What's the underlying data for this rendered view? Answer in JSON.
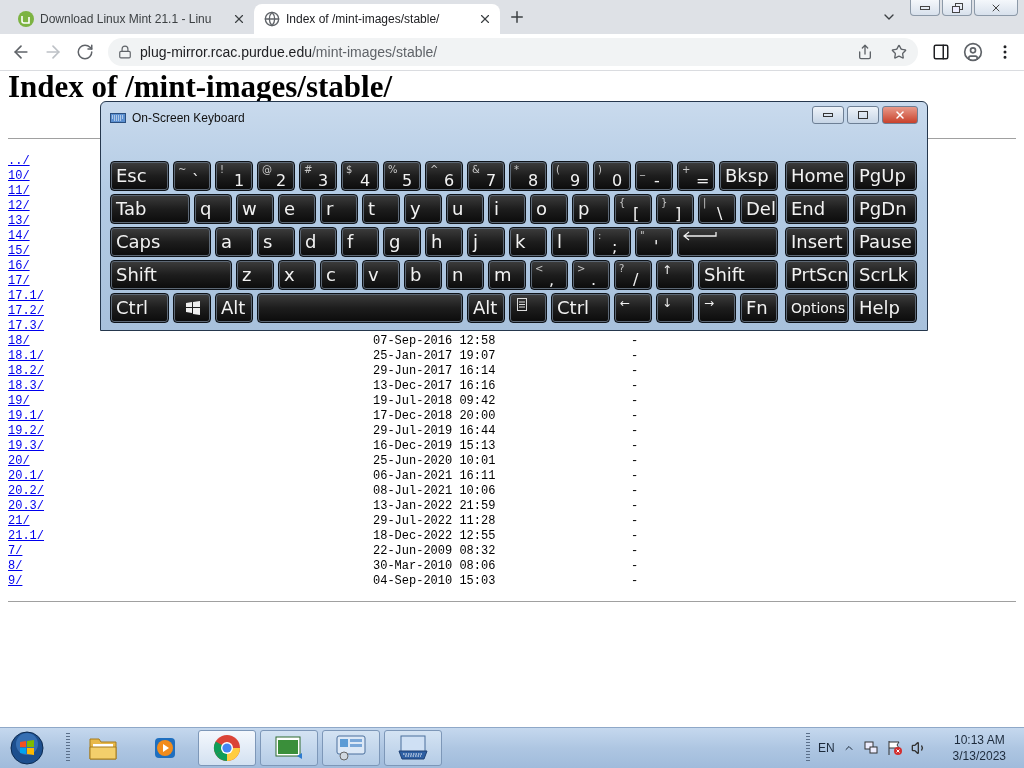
{
  "browser": {
    "tabs": [
      {
        "kind": "mint",
        "title": "Download Linux Mint 21.1 - Linu",
        "selected": false
      },
      {
        "kind": "globe",
        "title": "Index of /mint-images/stable/",
        "selected": true
      }
    ],
    "nav_buttons": [
      {
        "kind": "back",
        "disabled": false
      },
      {
        "kind": "forward",
        "disabled": true
      },
      {
        "kind": "reload",
        "disabled": false
      }
    ],
    "address": {
      "host": "plug-mirror.rcac.purdue.edu",
      "path": "/mint-images/stable/"
    }
  },
  "page": {
    "heading": "Index of /mint-images/stable/",
    "rows": [
      {
        "name": "../"
      },
      {
        "name": "10/"
      },
      {
        "name": "11/"
      },
      {
        "name": "12/"
      },
      {
        "name": "13/"
      },
      {
        "name": "14/"
      },
      {
        "name": "15/"
      },
      {
        "name": "16/"
      },
      {
        "name": "17/"
      },
      {
        "name": "17.1/"
      },
      {
        "name": "17.2/"
      },
      {
        "name": "17.3/"
      },
      {
        "name": "18/",
        "date": "07-Sep-2016 12:58",
        "size": "-"
      },
      {
        "name": "18.1/",
        "date": "25-Jan-2017 19:07",
        "size": "-"
      },
      {
        "name": "18.2/",
        "date": "29-Jun-2017 16:14",
        "size": "-"
      },
      {
        "name": "18.3/",
        "date": "13-Dec-2017 16:16",
        "size": "-"
      },
      {
        "name": "19/",
        "date": "19-Jul-2018 09:42",
        "size": "-"
      },
      {
        "name": "19.1/",
        "date": "17-Dec-2018 20:00",
        "size": "-"
      },
      {
        "name": "19.2/",
        "date": "29-Jul-2019 16:44",
        "size": "-"
      },
      {
        "name": "19.3/",
        "date": "16-Dec-2019 15:13",
        "size": "-"
      },
      {
        "name": "20/",
        "date": "25-Jun-2020 10:01",
        "size": "-"
      },
      {
        "name": "20.1/",
        "date": "06-Jan-2021 16:11",
        "size": "-"
      },
      {
        "name": "20.2/",
        "date": "08-Jul-2021 10:06",
        "size": "-"
      },
      {
        "name": "20.3/",
        "date": "13-Jan-2022 21:59",
        "size": "-"
      },
      {
        "name": "21/",
        "date": "29-Jul-2022 11:28",
        "size": "-"
      },
      {
        "name": "21.1/",
        "date": "18-Dec-2022 12:55",
        "size": "-"
      },
      {
        "name": "7/",
        "date": "22-Jun-2009 08:32",
        "size": "-"
      },
      {
        "name": "8/",
        "date": "30-Mar-2010 08:06",
        "size": "-"
      },
      {
        "name": "9/",
        "date": "04-Sep-2010 15:03",
        "size": "-"
      }
    ]
  },
  "keyboard": {
    "title": "On-Screen Keyboard",
    "rows": [
      {
        "keys": [
          {
            "kind": "wide15",
            "label": "Esc"
          },
          {
            "kind": "key",
            "shift": "~",
            "label": "`"
          },
          {
            "kind": "key",
            "shift": "!",
            "label": "1"
          },
          {
            "kind": "key",
            "shift": "@",
            "label": "2"
          },
          {
            "kind": "key",
            "shift": "#",
            "label": "3"
          },
          {
            "kind": "key",
            "shift": "$",
            "label": "4"
          },
          {
            "kind": "key",
            "shift": "%",
            "label": "5"
          },
          {
            "kind": "key",
            "shift": "^",
            "label": "6"
          },
          {
            "kind": "key",
            "shift": "&",
            "label": "7"
          },
          {
            "kind": "key",
            "shift": "*",
            "label": "8"
          },
          {
            "kind": "key",
            "shift": "(",
            "label": "9"
          },
          {
            "kind": "key",
            "shift": ")",
            "label": "0"
          },
          {
            "kind": "key",
            "shift": "_",
            "label": "-"
          },
          {
            "kind": "key",
            "shift": "+",
            "label": "="
          },
          {
            "kind": "wide15",
            "label": "Bksp"
          }
        ]
      },
      {
        "keys": [
          {
            "kind": "wide2",
            "label": "Tab"
          },
          {
            "kind": "key",
            "label": "q"
          },
          {
            "kind": "key",
            "label": "w"
          },
          {
            "kind": "key",
            "label": "e"
          },
          {
            "kind": "key",
            "label": "r"
          },
          {
            "kind": "key",
            "label": "t"
          },
          {
            "kind": "key",
            "label": "y"
          },
          {
            "kind": "key",
            "label": "u"
          },
          {
            "kind": "key",
            "label": "i"
          },
          {
            "kind": "key",
            "label": "o"
          },
          {
            "kind": "key",
            "label": "p"
          },
          {
            "kind": "key",
            "shift": "{",
            "label": "["
          },
          {
            "kind": "key",
            "shift": "}",
            "label": "]"
          },
          {
            "kind": "key",
            "shift": "|",
            "label": "\\"
          },
          {
            "kind": "key",
            "label": "Del"
          }
        ]
      },
      {
        "keys": [
          {
            "kind": "wide25",
            "label": "Caps"
          },
          {
            "kind": "key",
            "label": "a"
          },
          {
            "kind": "key",
            "label": "s"
          },
          {
            "kind": "key",
            "label": "d"
          },
          {
            "kind": "key",
            "label": "f"
          },
          {
            "kind": "key",
            "label": "g"
          },
          {
            "kind": "key",
            "label": "h"
          },
          {
            "kind": "key",
            "label": "j"
          },
          {
            "kind": "key",
            "label": "k"
          },
          {
            "kind": "key",
            "label": "l"
          },
          {
            "kind": "key",
            "shift": ":",
            "label": ";"
          },
          {
            "kind": "key",
            "shift": "\"",
            "label": "'"
          },
          {
            "kind": "enter"
          }
        ]
      },
      {
        "keys": [
          {
            "kind": "wide3",
            "label": "Shift"
          },
          {
            "kind": "key",
            "label": "z"
          },
          {
            "kind": "key",
            "label": "x"
          },
          {
            "kind": "key",
            "label": "c"
          },
          {
            "kind": "key",
            "label": "v"
          },
          {
            "kind": "key",
            "label": "b"
          },
          {
            "kind": "key",
            "label": "n"
          },
          {
            "kind": "key",
            "label": "m"
          },
          {
            "kind": "key",
            "shift": "<",
            "label": ","
          },
          {
            "kind": "key",
            "shift": ">",
            "label": "."
          },
          {
            "kind": "key",
            "shift": "?",
            "label": "/"
          },
          {
            "kind": "arrow",
            "label": "↑"
          },
          {
            "kind": "wide2",
            "label": "Shift"
          }
        ]
      },
      {
        "keys": [
          {
            "kind": "wide15",
            "label": "Ctrl"
          },
          {
            "kind": "windows"
          },
          {
            "kind": "key",
            "label": "Alt"
          },
          {
            "kind": "space"
          },
          {
            "kind": "key",
            "label": "Alt"
          },
          {
            "kind": "menu"
          },
          {
            "kind": "wide15",
            "label": "Ctrl"
          },
          {
            "kind": "arrow",
            "label": "←"
          },
          {
            "kind": "arrow",
            "label": "↓"
          },
          {
            "kind": "arrow",
            "label": "→"
          },
          {
            "kind": "key",
            "label": "Fn"
          }
        ]
      }
    ],
    "nav_rows": [
      [
        {
          "kind": "nav",
          "label": "Home"
        },
        {
          "kind": "nav",
          "label": "PgUp"
        }
      ],
      [
        {
          "kind": "nav",
          "label": "End"
        },
        {
          "kind": "nav",
          "label": "PgDn"
        }
      ],
      [
        {
          "kind": "nav",
          "label": "Insert"
        },
        {
          "kind": "nav",
          "label": "Pause"
        }
      ],
      [
        {
          "kind": "nav",
          "label": "PrtScn"
        },
        {
          "kind": "nav",
          "label": "ScrLk"
        }
      ],
      [
        {
          "kind": "nav_small",
          "label": "Options"
        },
        {
          "kind": "nav",
          "label": "Help"
        }
      ]
    ]
  },
  "taskbar": {
    "apps": [
      {
        "kind": "folder",
        "running": false,
        "active": false
      },
      {
        "kind": "media",
        "running": false,
        "active": false
      },
      {
        "kind": "chrome",
        "running": true,
        "active": true
      },
      {
        "kind": "csharp",
        "running": true,
        "active": false
      },
      {
        "kind": "panel",
        "running": true,
        "active": false
      },
      {
        "kind": "keyboard",
        "running": true,
        "active": false
      }
    ],
    "language": "EN",
    "time": "10:13 AM",
    "date": "3/13/2023"
  }
}
